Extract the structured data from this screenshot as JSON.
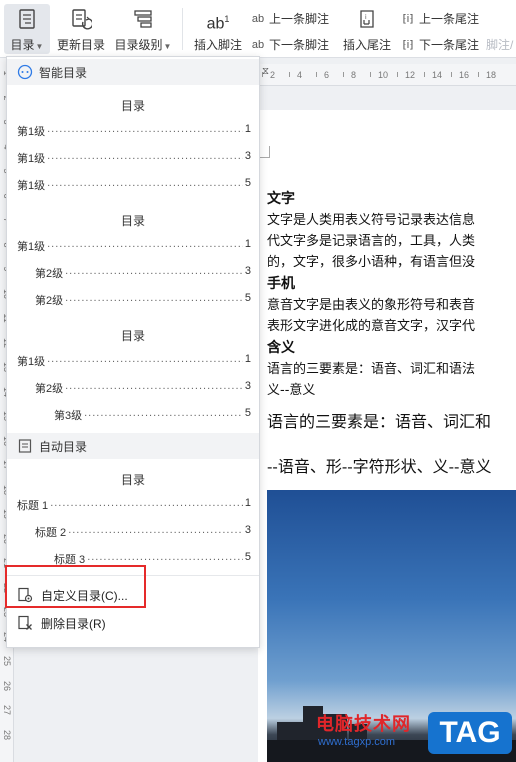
{
  "ribbon": {
    "toc_label": "目录",
    "update_label": "更新目录",
    "level_label": "目录级别",
    "insert_footnote_label": "插入脚注",
    "footnote_icon_text": "ab",
    "footnote_icon_sup": "1",
    "prev_footnote_label": "上一条脚注",
    "next_footnote_label": "下一条脚注",
    "insert_endnote_label": "插入尾注",
    "prev_endnote_label": "上一条尾注",
    "next_endnote_label": "下一条尾注",
    "footnote_separator_label": "脚注/"
  },
  "toc_menu": {
    "smart_section_label": "智能目录",
    "smart_tocs": [
      {
        "title": "目录",
        "entries": [
          {
            "label": "第1级",
            "page": "1",
            "level": 1
          },
          {
            "label": "第1级",
            "page": "3",
            "level": 1
          },
          {
            "label": "第1级",
            "page": "5",
            "level": 1
          }
        ]
      },
      {
        "title": "目录",
        "entries": [
          {
            "label": "第1级",
            "page": "1",
            "level": 1
          },
          {
            "label": "第2级",
            "page": "3",
            "level": 2
          },
          {
            "label": "第2级",
            "page": "5",
            "level": 2
          }
        ]
      },
      {
        "title": "目录",
        "entries": [
          {
            "label": "第1级",
            "page": "1",
            "level": 1
          },
          {
            "label": "第2级",
            "page": "3",
            "level": 2
          },
          {
            "label": "第3级",
            "page": "5",
            "level": 3
          }
        ]
      }
    ],
    "auto_section_label": "自动目录",
    "auto_toc": {
      "title": "目录",
      "entries": [
        {
          "label": "标题 1",
          "page": "1",
          "level": 1
        },
        {
          "label": "标题 2",
          "page": "3",
          "level": 2
        },
        {
          "label": "标题 3",
          "page": "5",
          "level": 3
        }
      ]
    },
    "custom_toc_label": "自定义目录(C)...",
    "delete_toc_label": "删除目录(R)"
  },
  "document": {
    "lines": [
      {
        "text": "文字",
        "style": "heading"
      },
      {
        "text": "文字是人类用表义符号记录表达信息",
        "style": "body"
      },
      {
        "text": "代文字多是记录语言的，工具，人类",
        "style": "body"
      },
      {
        "text": "的，文字，很多小语种，有语言但没",
        "style": "body"
      },
      {
        "text": "手机",
        "style": "heading"
      },
      {
        "text": "意音文字是由表义的象形符号和表音",
        "style": "body"
      },
      {
        "text": "表形文字进化成的意音文字，汉字代",
        "style": "body"
      },
      {
        "text": "含义",
        "style": "heading"
      },
      {
        "text": "语言的三要素是：语音、词汇和语法",
        "style": "body"
      },
      {
        "text": "义--意义",
        "style": "body"
      },
      {
        "text": "语言的三要素是：语音、词汇和",
        "style": "big"
      },
      {
        "text": "--语音、形--字符形状、义--意义",
        "style": "big"
      }
    ]
  },
  "ruler": {
    "h_numbers": [
      "2",
      "4",
      "6",
      "8",
      "10",
      "12",
      "14",
      "16",
      "18"
    ],
    "v_numbers": [
      "1",
      "2",
      "3",
      "4",
      "5",
      "6",
      "7",
      "8",
      "9",
      "10",
      "11",
      "12",
      "13",
      "14",
      "15",
      "16",
      "17",
      "18",
      "19",
      "20",
      "21",
      "22",
      "23",
      "24",
      "25",
      "26",
      "27",
      "28"
    ]
  },
  "watermark": {
    "site_name": "电脑技术网",
    "url": "www.tagxp.com",
    "tag": "TAG"
  },
  "colors": {
    "accent_blue": "#1673cf",
    "highlight_red": "#e52a2a",
    "watermark_red": "#e0262a"
  }
}
